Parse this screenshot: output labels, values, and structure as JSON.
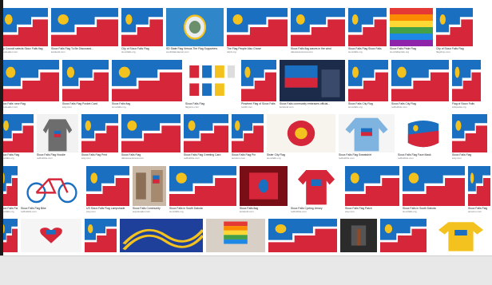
{
  "colors": {
    "flag_blue": "#1a6fc0",
    "flag_red": "#d6263a",
    "flag_gold": "#f4c21f",
    "flag_white": "#ffffff",
    "page_bg": "#ffffff",
    "bottom_bar": "#e8e8e8"
  },
  "results": [
    {
      "row": 0,
      "title": "City Council selects Sioux Falls flag",
      "source": "argusleader.com",
      "thumb": "flag-wide"
    },
    {
      "row": 0,
      "title": "Sioux Falls Flag To Be Discussed...",
      "source": "keloland.com",
      "thumb": "flag-tv"
    },
    {
      "row": 0,
      "title": "City of Sioux Falls Flag",
      "source": "siouxfalls.org",
      "thumb": "flag"
    },
    {
      "row": 0,
      "title": "SD State Flag Versus The Flag Supporters",
      "source": "southdakotapost.com",
      "thumb": "sd-flag"
    },
    {
      "row": 0,
      "title": "The Flag People Also Chose",
      "source": "sdpb.org",
      "thumb": "flag-building"
    },
    {
      "row": 0,
      "title": "Sioux Falls flag waves in the wind",
      "source": "dakotanewsnow.com",
      "thumb": "flag-sky"
    },
    {
      "row": 0,
      "title": "Sioux Falls Flag Sioux Falls",
      "source": "siouxfalls.org",
      "thumb": "flag-small"
    },
    {
      "row": 0,
      "title": "Sioux Falls Pride Flag",
      "source": "siouxfallspride.org",
      "thumb": "rainbow"
    },
    {
      "row": 0,
      "title": "City of Sioux Falls Flag",
      "source": "flagshop.com",
      "thumb": "flag-wave"
    },
    {
      "row": 1,
      "title": "Sioux Falls' new Flag",
      "source": "argusleader.com",
      "thumb": "flag-pattern"
    },
    {
      "row": 1,
      "title": "Sioux Falls Flag Pocket Card",
      "source": "etsy.com",
      "thumb": "flag-card"
    },
    {
      "row": 1,
      "title": "Sioux Falls flag",
      "source": "siouxfalls.org",
      "thumb": "flag-sky2"
    },
    {
      "row": 1,
      "title": "Sioux Falls Flag",
      "source": "flagsrus.com",
      "thumb": "swatches"
    },
    {
      "row": 1,
      "title": "Pinwheel Flag of Sioux Falls",
      "source": "reddit.com",
      "thumb": "flag-inset"
    },
    {
      "row": 1,
      "title": "Sioux Falls community embraces official...",
      "source": "keloland.com",
      "thumb": "news-room"
    },
    {
      "row": 1,
      "title": "Sioux Falls City Flag",
      "source": "siouxfalls.org",
      "thumb": "flag-frame"
    },
    {
      "row": 1,
      "title": "Sioux Falls City Flag",
      "source": "redbubble.com",
      "thumb": "flag-emblem"
    },
    {
      "row": 1,
      "title": "Flag of Sioux Falls",
      "source": "wikipedia.org",
      "thumb": "flag-edge"
    },
    {
      "row": 2,
      "title": "Sioux Falls Flag",
      "source": "siouxfalls.org",
      "thumb": "flag-angled"
    },
    {
      "row": 2,
      "title": "Sioux Falls Flag Hoodie",
      "source": "redbubble.com",
      "thumb": "hoodie"
    },
    {
      "row": 2,
      "title": "Sioux Falls Flag Print",
      "source": "etsy.com",
      "thumb": "flag-small2"
    },
    {
      "row": 2,
      "title": "Sioux Falls Flag",
      "source": "dakotanewsnow.com",
      "thumb": "flag-wave2"
    },
    {
      "row": 2,
      "title": "Sioux Falls Flag Greeting Card",
      "source": "redbubble.com",
      "thumb": "flag-tilt"
    },
    {
      "row": 2,
      "title": "Sioux Falls Flag Pin",
      "source": "amazon.com",
      "thumb": "flag-white"
    },
    {
      "row": 2,
      "title": "Sister City Flag",
      "source": "siouxfalls.org",
      "thumb": "red-seal"
    },
    {
      "row": 2,
      "title": "Sioux Falls Flag Sweatshirt",
      "source": "redbubble.com",
      "thumb": "sweater"
    },
    {
      "row": 2,
      "title": "Sioux Falls Flag Face Mask",
      "source": "redbubble.com",
      "thumb": "mask"
    },
    {
      "row": 2,
      "title": "Sioux Falls Flag",
      "source": "etsy.com",
      "thumb": "flag-strip"
    },
    {
      "row": 3,
      "title": "Sioux Falls Flag",
      "source": "siouxfalls.org",
      "thumb": "flag-arc"
    },
    {
      "row": 3,
      "title": "Sioux Falls Flag Bike",
      "source": "redbubble.com",
      "thumb": "bike"
    },
    {
      "row": 3,
      "title": "US Sioux Falls Flag Lampshade",
      "source": "etsy.com",
      "thumb": "flag-us"
    },
    {
      "row": 3,
      "title": "Sioux Falls Community",
      "source": "argusleader.com",
      "thumb": "building"
    },
    {
      "row": 3,
      "title": "Sioux Falls in South Dakota",
      "source": "siouxfalls.org",
      "thumb": "flag-sd"
    },
    {
      "row": 3,
      "title": "Sioux Falls flag",
      "source": "keloland.com",
      "thumb": "red-room"
    },
    {
      "row": 3,
      "title": "Sioux Falls Cycling Jersey",
      "source": "redbubble.com",
      "thumb": "shirt"
    },
    {
      "row": 3,
      "title": "Sioux Falls Flag Patch",
      "source": "etsy.com",
      "thumb": "patch"
    },
    {
      "row": 3,
      "title": "Sioux Falls in South Dakota",
      "source": "siouxfalls.org",
      "thumb": "flag-wide2"
    },
    {
      "row": 3,
      "title": "Sioux Falls Flag",
      "source": "amazon.com",
      "thumb": "flag-corner"
    },
    {
      "row": 4,
      "title": "",
      "source": "",
      "thumb": "flag-crop"
    },
    {
      "row": 4,
      "title": "",
      "source": "",
      "thumb": "heart-logo"
    },
    {
      "row": 4,
      "title": "",
      "source": "",
      "thumb": "flag-shop"
    },
    {
      "row": 4,
      "title": "",
      "source": "",
      "thumb": "gold-wave"
    },
    {
      "row": 4,
      "title": "",
      "source": "",
      "thumb": "pride-pole"
    },
    {
      "row": 4,
      "title": "",
      "source": "",
      "thumb": "flag-pole"
    },
    {
      "row": 4,
      "title": "",
      "source": "",
      "thumb": "dark-room"
    },
    {
      "row": 4,
      "title": "",
      "source": "",
      "thumb": "flag-pair"
    },
    {
      "row": 4,
      "title": "",
      "source": "",
      "thumb": "shirt-yellow"
    }
  ]
}
